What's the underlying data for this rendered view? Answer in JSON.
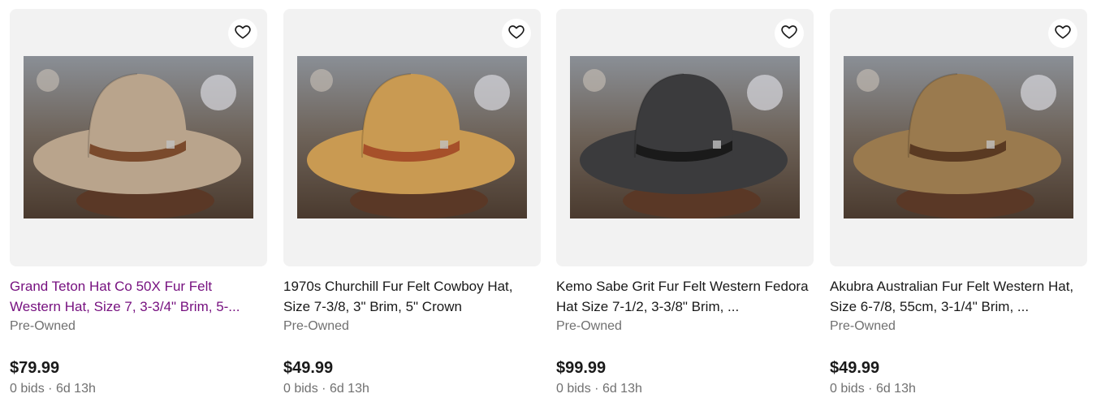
{
  "listings": [
    {
      "title": "Grand Teton Hat Co 50X Fur Felt Western Hat, Size 7, 3-3/4\" Brim, 5-...",
      "condition": "Pre-Owned",
      "price": "$79.99",
      "bids": "0 bids",
      "separator": "·",
      "time_left": "6d 13h",
      "visited": true,
      "hat_color": "#b9a48c",
      "band_color": "#7a4a2c"
    },
    {
      "title": "1970s Churchill Fur Felt Cowboy Hat, Size 7-3/8, 3\" Brim, 5\" Crown",
      "condition": "Pre-Owned",
      "price": "$49.99",
      "bids": "0 bids",
      "separator": "·",
      "time_left": "6d 13h",
      "visited": false,
      "hat_color": "#c99a52",
      "band_color": "#a6502a"
    },
    {
      "title": "Kemo Sabe Grit Fur Felt Western Fedora Hat Size 7-1/2, 3-3/8\" Brim, ...",
      "condition": "Pre-Owned",
      "price": "$99.99",
      "bids": "0 bids",
      "separator": "·",
      "time_left": "6d 13h",
      "visited": false,
      "hat_color": "#3b3b3d",
      "band_color": "#1a1a1a"
    },
    {
      "title": "Akubra Australian Fur Felt Western Hat, Size 6-7/8, 55cm, 3-1/4\" Brim, ...",
      "condition": "Pre-Owned",
      "price": "$49.99",
      "bids": "0 bids",
      "separator": "·",
      "time_left": "6d 13h",
      "visited": false,
      "hat_color": "#9a7a4e",
      "band_color": "#5a3a22"
    }
  ],
  "icons": {
    "watch": "heart-icon"
  },
  "colors": {
    "visited_link": "#76107f",
    "secondary_text": "#707070",
    "card_bg": "#f2f2f2"
  }
}
